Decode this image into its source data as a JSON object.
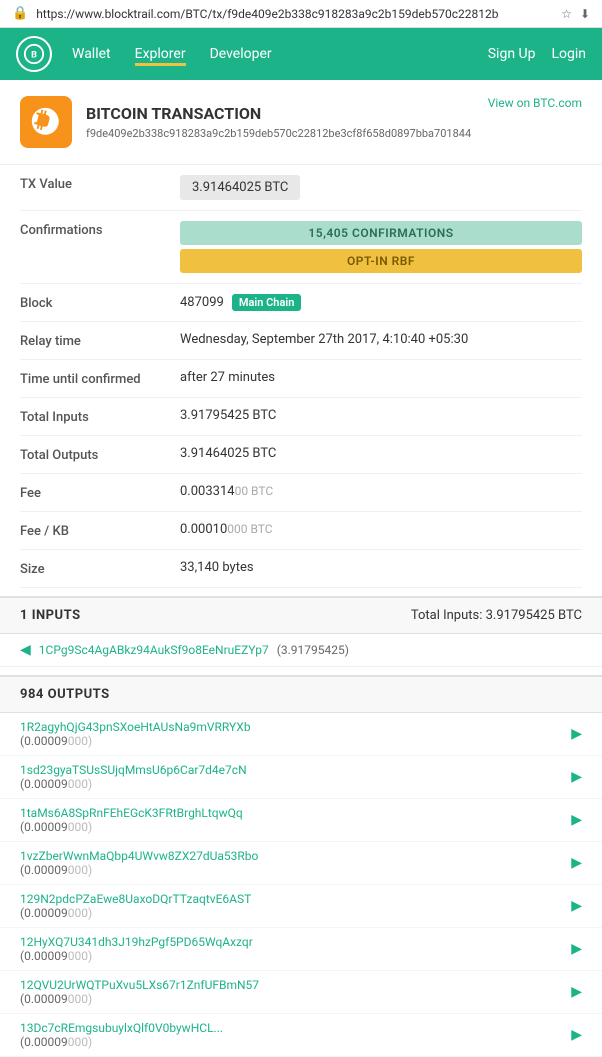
{
  "nav": {
    "logo_alt": "BlockTrail",
    "links": [
      {
        "label": "Wallet",
        "active": false
      },
      {
        "label": "Explorer",
        "active": true
      },
      {
        "label": "Developer",
        "active": false
      }
    ],
    "right": [
      {
        "label": "Sign Up"
      },
      {
        "label": "Login"
      }
    ]
  },
  "address_bar": {
    "url": "https://www.blocktrail.com/BTC/tx/f9de409e2b338c918283a9c2b159deb570c22812b",
    "lock_icon": "🔒"
  },
  "transaction": {
    "logo_alt": "Bitcoin",
    "title": "BITCOIN TRANSACTION",
    "view_on_btc": "View on BTC.com",
    "hash": "f9de409e2b338c918283a9c2b159deb570c22812be3cf8f658d0897bba701844",
    "fields": [
      {
        "label": "TX Value",
        "value": "3.91464025 BTC",
        "type": "value-box"
      },
      {
        "label": "Confirmations",
        "value": "15,405 CONFIRMATIONS",
        "sub": "OPT-IN RBF",
        "type": "confirmations"
      },
      {
        "label": "Block",
        "value": "487099",
        "badge": "Main Chain",
        "type": "block"
      },
      {
        "label": "Relay time",
        "value": "Wednesday, September 27th 2017, 4:10:40 +05:30",
        "type": "text"
      },
      {
        "label": "Time until confirmed",
        "value": "after 27 minutes",
        "type": "text"
      },
      {
        "label": "Total Inputs",
        "value": "3.91795425 BTC",
        "type": "text"
      },
      {
        "label": "Total Outputs",
        "value": "3.91464025 BTC",
        "type": "text"
      },
      {
        "label": "Fee",
        "value": "0.003314",
        "sub": "00 BTC",
        "type": "fee"
      },
      {
        "label": "Fee / KB",
        "value": "0.00010",
        "sub": "000 BTC",
        "type": "fee"
      },
      {
        "label": "Size",
        "value": "33,140 bytes",
        "type": "text"
      }
    ]
  },
  "inputs_section": {
    "title": "1 INPUTS",
    "total_label": "Total Inputs:",
    "total_value": "3.91795425 BTC",
    "items": [
      {
        "address": "1CPg9Sc4AgABkz94AukSf9o8EeNruEZYp7",
        "amount": "(3.91795425)"
      }
    ]
  },
  "outputs_section": {
    "title": "984 OUTPUTS",
    "items": [
      {
        "address": "1R2agyhQjG43pnSXoeHtAUsNa9mVRRYXb",
        "amount": "(0.00009",
        "sub": "000)"
      },
      {
        "address": "1sd23gyaTSUsSUjqMmsU6p6Car7d4e7cN",
        "amount": "(0.00009",
        "sub": "000)"
      },
      {
        "address": "1taMs6A8SpRnFEhEGcK3FRtBrghLtqwQq",
        "amount": "(0.00009",
        "sub": "000)"
      },
      {
        "address": "1vzZberWwnMaQbp4UWvw8ZX27dUa53Rbo",
        "amount": "(0.00009",
        "sub": "000)"
      },
      {
        "address": "129N2pdcPZaEwe8UaxoDQrTTzaqtvE6AST",
        "amount": "(0.00009",
        "sub": "000)"
      },
      {
        "address": "12HyXQ7U341dh3J19hzPgf5PD65WqAxzqr",
        "amount": "(0.00009",
        "sub": "000)"
      },
      {
        "address": "12QVU2UrWQTPuXvu5LXs67r1ZnfUFBmN57",
        "amount": "(0.00009",
        "sub": "000)"
      },
      {
        "address": "13Dc7cREmgsubuylxQlf0V0bywHCL...",
        "amount": "(0.00009",
        "sub": "000)"
      }
    ]
  }
}
